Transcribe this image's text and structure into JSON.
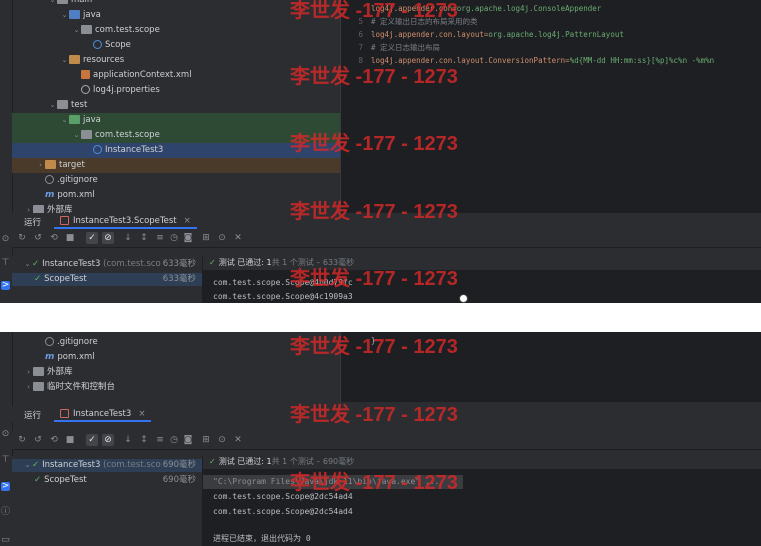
{
  "top": {
    "tree": [
      {
        "indent": 3,
        "chev": "v",
        "icon": "folder",
        "label": "main",
        "cls": ""
      },
      {
        "indent": 4,
        "chev": "v",
        "icon": "folder-blue",
        "label": "java",
        "cls": ""
      },
      {
        "indent": 5,
        "chev": "v",
        "icon": "folder",
        "label": "com.test.scope",
        "cls": ""
      },
      {
        "indent": 6,
        "chev": "",
        "icon": "class",
        "label": "Scope",
        "cls": ""
      },
      {
        "indent": 4,
        "chev": "v",
        "icon": "folder-orange",
        "label": "resources",
        "cls": ""
      },
      {
        "indent": 5,
        "chev": "",
        "icon": "xml",
        "label": "applicationContext.xml",
        "cls": ""
      },
      {
        "indent": 5,
        "chev": "",
        "icon": "gear",
        "label": "log4j.properties",
        "cls": ""
      },
      {
        "indent": 3,
        "chev": "v",
        "icon": "folder",
        "label": "test",
        "cls": ""
      },
      {
        "indent": 4,
        "chev": "v",
        "icon": "folder-green",
        "label": "java",
        "cls": "sel"
      },
      {
        "indent": 5,
        "chev": "v",
        "icon": "folder",
        "label": "com.test.scope",
        "cls": "sel"
      },
      {
        "indent": 6,
        "chev": "",
        "icon": "class",
        "label": "InstanceTest3",
        "cls": "blue"
      },
      {
        "indent": 2,
        "chev": ">",
        "icon": "folder-orange",
        "label": "target",
        "cls": "hl"
      },
      {
        "indent": 2,
        "chev": "",
        "icon": "ban",
        "label": ".gitignore",
        "cls": ""
      },
      {
        "indent": 2,
        "chev": "",
        "icon": "maven",
        "label": "pom.xml",
        "cls": ""
      },
      {
        "indent": 1,
        "chev": ">",
        "icon": "lib",
        "label": "外部库",
        "cls": ""
      }
    ],
    "code": [
      {
        "n": "",
        "key": "log4j.appender.con=",
        "val": "org.apache.log4j.ConsoleAppender",
        "comment": ""
      },
      {
        "n": "5",
        "key": "",
        "val": "",
        "comment": "# 定义输出日志的布局采用的类"
      },
      {
        "n": "6",
        "key": "log4j.appender.con.layout=",
        "val": "org.apache.log4j.PatternLayout",
        "comment": ""
      },
      {
        "n": "7",
        "key": "",
        "val": "",
        "comment": "# 定义日志输出布局"
      },
      {
        "n": "8",
        "key": "log4j.appender.con.layout.ConversionPattern=",
        "val": "%d{MM-dd HH:mm:ss}[%p]%c%n -%m%n",
        "comment": ""
      }
    ],
    "run_label": "运行",
    "run_tab": "InstanceTest3.ScopeTest",
    "results": [
      {
        "name": "InstanceTest3",
        "pkg": "(com.test.sco",
        "time": "633毫秒",
        "indent": 1,
        "cls": ""
      },
      {
        "name": "ScopeTest",
        "pkg": "",
        "time": "633毫秒",
        "indent": 2,
        "cls": "sel"
      }
    ],
    "status_prefix": "测试 已通过:",
    "status_bold": "1",
    "status_suffix": "共 1 个测试 – 633毫秒",
    "console": [
      "com.test.scope.Scope@4b0d79fc",
      "com.test.scope.Scope@4c1909a3"
    ]
  },
  "bottom": {
    "tree": [
      {
        "indent": 2,
        "chev": "",
        "icon": "ban",
        "label": ".gitignore",
        "cls": ""
      },
      {
        "indent": 2,
        "chev": "",
        "icon": "maven",
        "label": "pom.xml",
        "cls": ""
      },
      {
        "indent": 1,
        "chev": ">",
        "icon": "lib",
        "label": "外部库",
        "cls": ""
      },
      {
        "indent": 1,
        "chev": ">",
        "icon": "lib",
        "label": "临时文件和控制台",
        "cls": ""
      }
    ],
    "code_brace": "}",
    "run_label": "运行",
    "run_tab": "InstanceTest3",
    "results": [
      {
        "name": "InstanceTest3",
        "pkg": "(com.test.sco",
        "time": "690毫秒",
        "indent": 1,
        "cls": "sel"
      },
      {
        "name": "ScopeTest",
        "pkg": "",
        "time": "690毫秒",
        "indent": 2,
        "cls": ""
      }
    ],
    "status_prefix": "测试 已通过:",
    "status_bold": "1",
    "status_suffix": "共 1 个测试 – 690毫秒",
    "console_cmd": "\"C:\\Program Files\\Java\\jdk-11\\bin\\java.exe\" ...",
    "console": [
      "com.test.scope.Scope@2dc54ad4",
      "com.test.scope.Scope@2dc54ad4"
    ],
    "exit_text": "进程已结束，退出代码为 0"
  },
  "watermarks": [
    "李世发 -177 - 1273",
    "李世发 -177 - 1273",
    "李世发 -177 - 1273",
    "李世发 -177 - 1273",
    "李世发 -177 - 1273",
    "李世发 -177 - 1273",
    "李世发 -177 - 1273",
    "李世发 -177 - 1273"
  ],
  "colors": {
    "pass": "#5fb865",
    "accent": "#3574f0",
    "watermark": "#d72828"
  }
}
